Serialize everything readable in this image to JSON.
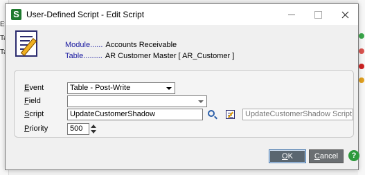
{
  "background": {
    "left_fragments": [
      "Ev",
      "Ta",
      "Ta"
    ],
    "right_dot_colors": [
      "#3aa64a",
      "#d9534f",
      "#cc2222",
      "#e0a020"
    ]
  },
  "window": {
    "title": "User-Defined Script - Edit Script",
    "app_icon_glyph": "S"
  },
  "header": {
    "module_label": "Module......",
    "module_value": "Accounts Receivable",
    "table_label": "Table.........",
    "table_value": "AR Customer Master  [ AR_Customer ]"
  },
  "form": {
    "event": {
      "label_u": "E",
      "label_rest": "vent",
      "value": "Table - Post-Write"
    },
    "field": {
      "label_u": "F",
      "label_rest": "ield",
      "value": ""
    },
    "script": {
      "label_u": "S",
      "label_rest": "cript",
      "value": "UpdateCustomerShadow",
      "description": "UpdateCustomerShadow Script"
    },
    "priority": {
      "label_u": "P",
      "label_rest": "riority",
      "value": "500"
    }
  },
  "buttons": {
    "ok_u": "O",
    "ok_rest": "K",
    "cancel_u": "C",
    "cancel_rest": "ancel",
    "help_glyph": "?"
  },
  "colors": {
    "label_blue": "#1a1aa0",
    "app_green": "#1e7a2e",
    "help_green": "#2e9a3c"
  }
}
